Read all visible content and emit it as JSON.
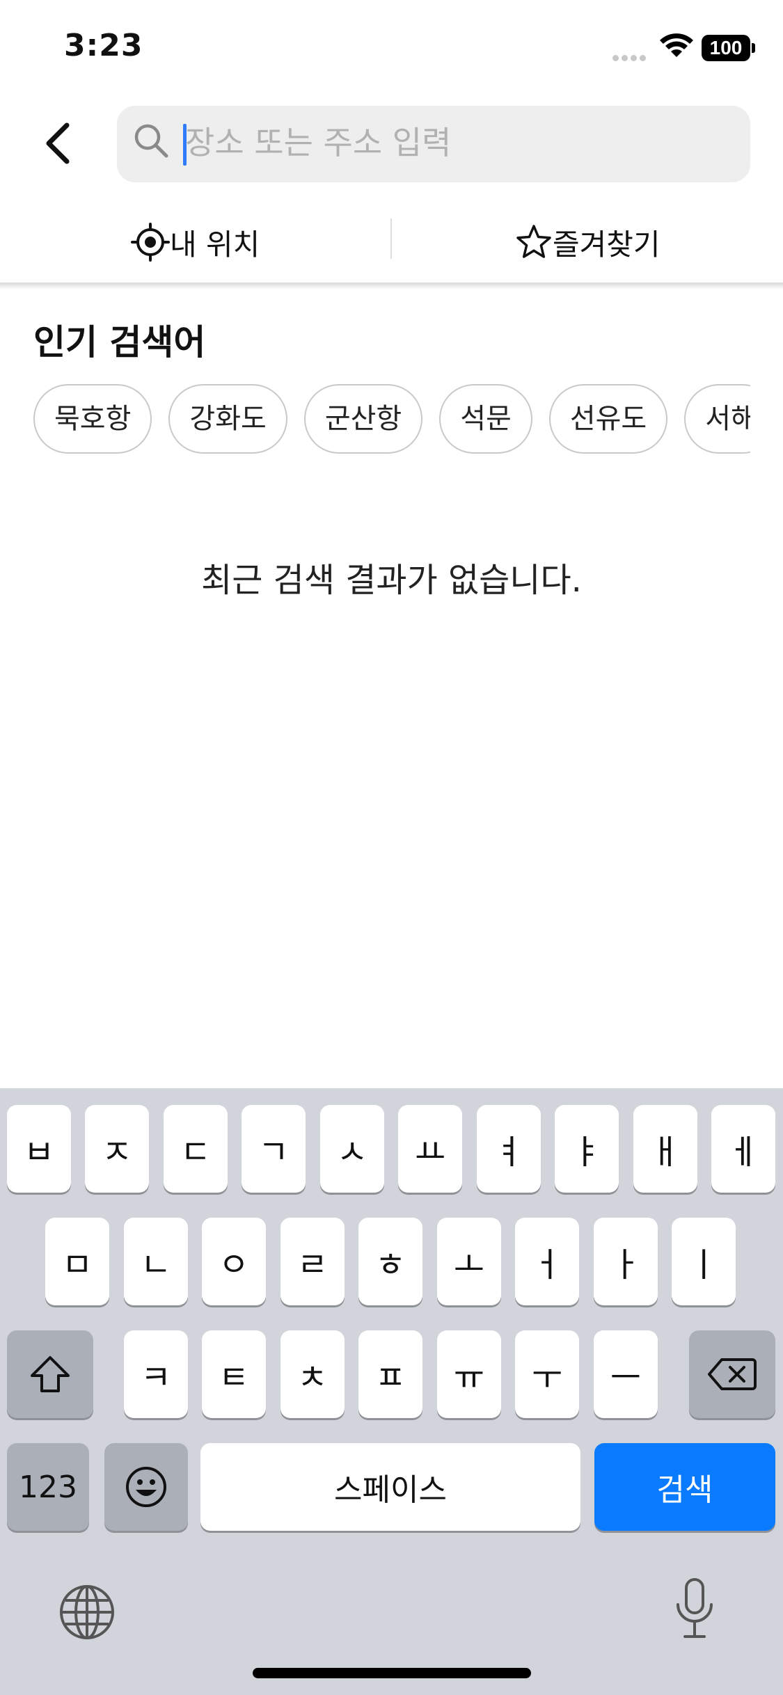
{
  "status_bar": {
    "time": "3:23",
    "battery": "100"
  },
  "search": {
    "placeholder": "장소 또는 주소 입력",
    "value": ""
  },
  "quick_actions": {
    "my_location": "내 위치",
    "favorites": "즐겨찾기"
  },
  "popular": {
    "title": "인기 검색어",
    "terms": [
      "묵호항",
      "강화도",
      "군산항",
      "석문",
      "선유도",
      "서해"
    ]
  },
  "recent": {
    "empty_message": "최근 검색 결과가 없습니다."
  },
  "keyboard": {
    "row1": [
      "ㅂ",
      "ㅈ",
      "ㄷ",
      "ㄱ",
      "ㅅ",
      "ㅛ",
      "ㅕ",
      "ㅑ",
      "ㅐ",
      "ㅔ"
    ],
    "row2": [
      "ㅁ",
      "ㄴ",
      "ㅇ",
      "ㄹ",
      "ㅎ",
      "ㅗ",
      "ㅓ",
      "ㅏ",
      "ㅣ"
    ],
    "row3": [
      "ㅋ",
      "ㅌ",
      "ㅊ",
      "ㅍ",
      "ㅠ",
      "ㅜ",
      "ㅡ"
    ],
    "numbers_label": "123",
    "space_label": "스페이스",
    "search_label": "검색"
  },
  "icons": {
    "back": "chevron-left-icon",
    "search": "magnifier-icon",
    "location": "crosshair-icon",
    "favorite": "star-outline-icon",
    "shift": "shift-arrow-icon",
    "delete": "backspace-icon",
    "emoji": "smiley-icon",
    "globe": "globe-icon",
    "mic": "microphone-icon"
  },
  "colors": {
    "accent": "#0a7aff",
    "caret": "#2f7cf6",
    "keyboard_bg": "#d1d4da"
  }
}
